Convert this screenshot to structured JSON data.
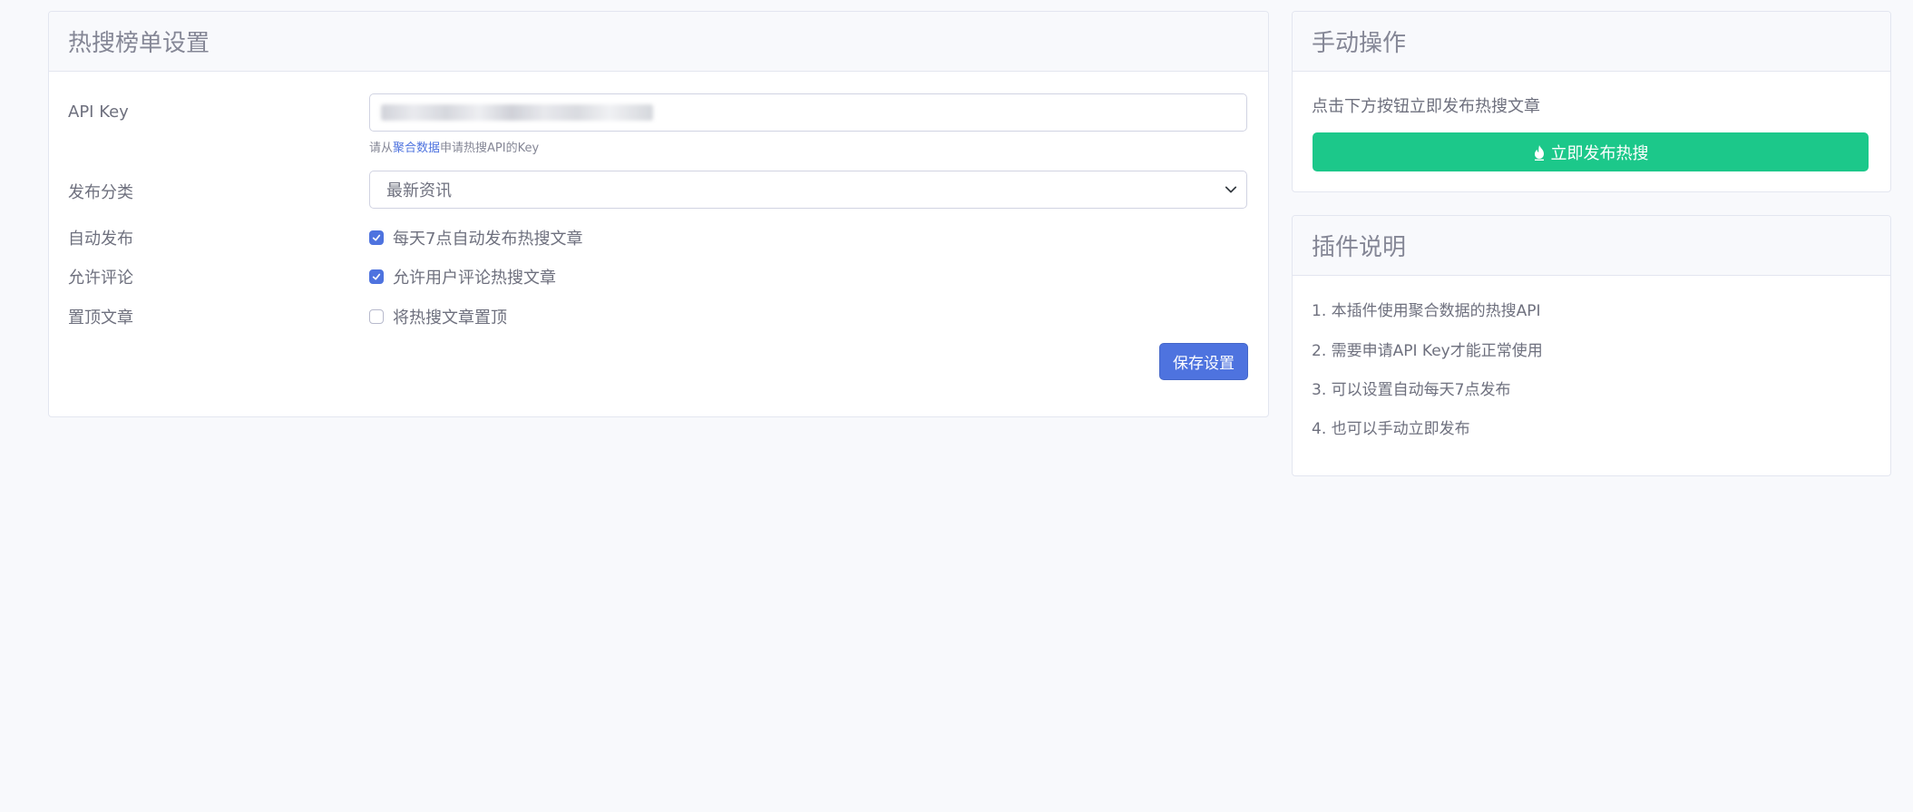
{
  "settings": {
    "title": "热搜榜单设置",
    "api_key": {
      "label": "API Key",
      "value": "••••••••••••••••••••••••••••••••••••",
      "help_prefix": "请从",
      "help_link": "聚合数据",
      "help_suffix": "申请热搜API的Key"
    },
    "category": {
      "label": "发布分类",
      "selected": "最新资讯"
    },
    "auto_publish": {
      "label": "自动发布",
      "checkbox_label": "每天7点自动发布热搜文章",
      "checked": true
    },
    "allow_comments": {
      "label": "允许评论",
      "checkbox_label": "允许用户评论热搜文章",
      "checked": true
    },
    "pin_article": {
      "label": "置顶文章",
      "checkbox_label": "将热搜文章置顶",
      "checked": false
    },
    "save_label": "保存设置"
  },
  "manual": {
    "title": "手动操作",
    "description": "点击下方按钮立即发布热搜文章",
    "publish_label": "立即发布热搜"
  },
  "about": {
    "title": "插件说明",
    "items": [
      "1. 本插件使用聚合数据的热搜API",
      "2. 需要申请API Key才能正常使用",
      "3. 可以设置自动每天7点发布",
      "4. 也可以手动立即发布"
    ]
  },
  "colors": {
    "primary": "#4e73df",
    "success": "#1cc88a",
    "background": "#f8f9fc",
    "text": "#6e707e"
  },
  "icons": {
    "checkbox": "check-icon",
    "select": "chevron-down-icon",
    "publish": "fire-icon"
  }
}
